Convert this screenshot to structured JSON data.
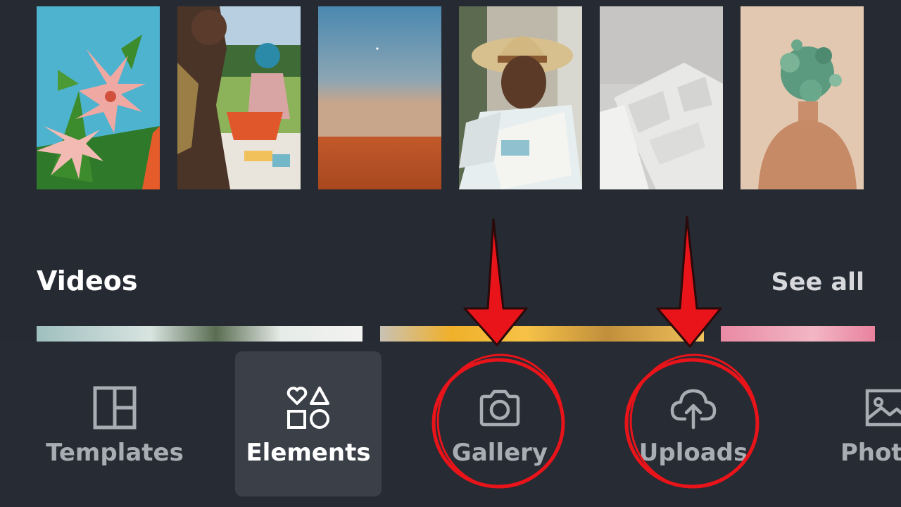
{
  "photos": [
    {
      "subject": "pink lily flowers against blue sky"
    },
    {
      "subject": "people having a picnic on grass"
    },
    {
      "subject": "desert horizon at dusk"
    },
    {
      "subject": "smiling man in straw hat reading newspaper"
    },
    {
      "subject": "abstract white shapes with shadows"
    },
    {
      "subject": "person with plant foliage over head"
    }
  ],
  "videos_section": {
    "title": "Videos",
    "see_all": "See all"
  },
  "bottom_nav": {
    "items": [
      {
        "label": "Templates",
        "icon": "templates-icon",
        "active": false
      },
      {
        "label": "Elements",
        "icon": "elements-icon",
        "active": true
      },
      {
        "label": "Gallery",
        "icon": "camera-icon",
        "active": false
      },
      {
        "label": "Uploads",
        "icon": "cloud-upload-icon",
        "active": false
      },
      {
        "label": "Photos",
        "icon": "image-icon",
        "active": false
      }
    ]
  },
  "colors": {
    "background": "#252a33",
    "nav_active_bg": "#3a3f48",
    "annotation": "#e8141a"
  }
}
